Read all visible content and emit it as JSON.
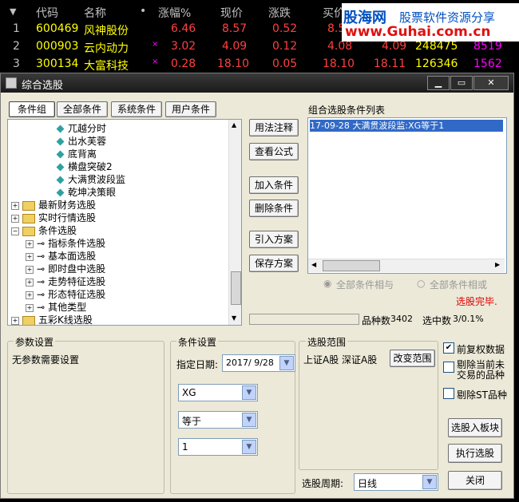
{
  "table": {
    "headers": {
      "sort": "▼",
      "code": "代码",
      "name": "名称",
      "dot": "•",
      "change_pct": "涨幅%",
      "price": "现价",
      "change": "涨跌",
      "buy": "买价"
    },
    "rows": [
      {
        "num": "1",
        "code": "600469",
        "name": "风神股份",
        "mark": "",
        "pct": "6.46",
        "price": "8.57",
        "change": "0.52",
        "buy": "8.5",
        "sell": "",
        "vol": "",
        "extra": ""
      },
      {
        "num": "2",
        "code": "000903",
        "name": "云内动力",
        "mark": "×",
        "pct": "3.02",
        "price": "4.09",
        "change": "0.12",
        "buy": "4.08",
        "sell": "4.09",
        "vol": "248475",
        "extra": "8519"
      },
      {
        "num": "3",
        "code": "300134",
        "name": "大富科技",
        "mark": "×",
        "pct": "0.28",
        "price": "18.10",
        "change": "0.05",
        "buy": "18.10",
        "sell": "18.11",
        "vol": "126346",
        "extra": "1562"
      }
    ]
  },
  "watermark": {
    "brand": "股海网",
    "slogan": "股票软件资源分享",
    "url": "www.Guhai.com.cn"
  },
  "dialog": {
    "title": "综合选股",
    "win_buttons": {
      "min": "▁",
      "max": "▭",
      "close": "✕"
    },
    "tabs": [
      "条件组",
      "全部条件",
      "系统条件",
      "用户条件"
    ],
    "tree_leaves": [
      "兀越分时",
      "出水芙蓉",
      "底背离",
      "横盘突破2",
      "大满贯波段监",
      "乾坤决策眼"
    ],
    "tree_folders_top": [
      "最新财务选股",
      "实时行情选股",
      "条件选股"
    ],
    "tree_sub": [
      "指标条件选股",
      "基本面选股",
      "即时盘中选股",
      "走势特征选股",
      "形态特征选股",
      "其他类型"
    ],
    "tree_folder_bottom": "五彩K线选股",
    "mid_buttons": {
      "usage": "用法注释",
      "formula": "查看公式",
      "add": "加入条件",
      "delete": "删除条件",
      "import": "引入方案",
      "save": "保存方案"
    },
    "combo_list_label": "组合选股条件列表",
    "combo_list_items": [
      "17-09-28 大满贯波段监:XG等于1"
    ],
    "radio_and": "全部条件相与",
    "radio_or": "全部条件相或",
    "status": "选股完毕.",
    "stock_count_label": "品种数",
    "stock_count": "3402",
    "selected_label": "选中数",
    "selected": "3/0.1%",
    "param_group": "参数设置",
    "param_text": "无参数需要设置",
    "cond_group": "条件设置",
    "date_label": "指定日期:",
    "date_value": "2017/ 9/28",
    "combo1": "XG",
    "combo2": "等于",
    "combo3": "1",
    "range_group": "选股范围",
    "range_text": "上证A股 深证A股",
    "range_button": "改变范围",
    "chk_fq": "前复权数据",
    "chk_fq_checked": "✔",
    "chk_remove_halt": "剔除当前未交易的品种",
    "chk_remove_st": "剔除ST品种",
    "btn_to_block": "选股入板块",
    "btn_run": "执行选股",
    "period_label": "选股周期:",
    "period_value": "日线",
    "btn_close": "关闭"
  }
}
